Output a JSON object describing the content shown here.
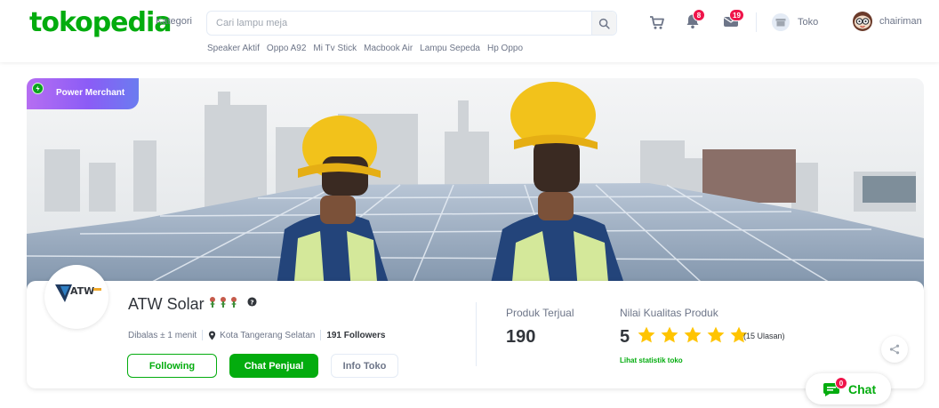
{
  "header": {
    "logo": "tokopedia",
    "kategori": "Kategori",
    "search_placeholder": "Cari lampu meja",
    "suggestions": [
      "Speaker Aktif",
      "Oppo A92",
      "Mi Tv Stick",
      "Macbook Air",
      "Lampu Sepeda",
      "Hp Oppo"
    ],
    "notif_count": "8",
    "inbox_count": "19",
    "toko_label": "Toko",
    "username": "chairiman"
  },
  "banner": {
    "badge_label": "Power Merchant"
  },
  "shop": {
    "logo_text": "ATW",
    "name": "ATW Solar",
    "reply_time": "Dibalas ± 1 menit",
    "location": "Kota Tangerang Selatan",
    "followers": "191 Followers",
    "following_button": "Following",
    "chat_button": "Chat Penjual",
    "info_button": "Info Toko"
  },
  "stats": {
    "sold_label": "Produk Terjual",
    "sold_value": "190",
    "quality_label": "Nilai Kualitas Produk",
    "rating_value": "5",
    "rating_stars": 5,
    "reviews": "(15 Ulasan)",
    "stats_link": "Lihat statistik toko"
  },
  "chat_float": {
    "label": "Chat",
    "badge": "0"
  },
  "colors": {
    "brand_green": "#03ac0e",
    "star": "#ffc400",
    "badge_red": "#ef144a",
    "power_merchant": "#8b5cf6"
  }
}
